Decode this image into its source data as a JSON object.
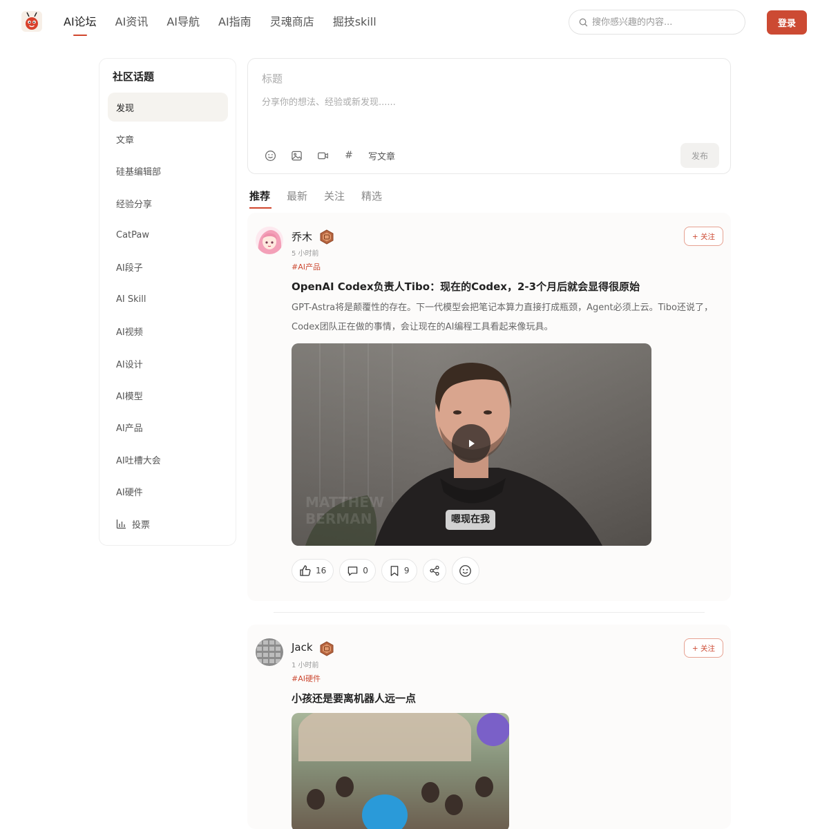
{
  "header": {
    "logo_icon": "ant-mascot-icon",
    "nav": [
      {
        "label": "AI论坛",
        "active": true
      },
      {
        "label": "AI资讯",
        "active": false
      },
      {
        "label": "AI导航",
        "active": false
      },
      {
        "label": "AI指南",
        "active": false
      },
      {
        "label": "灵魂商店",
        "active": false
      },
      {
        "label": "掘技skill",
        "active": false
      }
    ],
    "search_placeholder": "搜你感兴趣的内容...",
    "login_label": "登录",
    "accent_color": "#cc4a33"
  },
  "sidebar": {
    "title": "社区话题",
    "items": [
      {
        "label": "发现",
        "active": true
      },
      {
        "label": "文章"
      },
      {
        "label": "硅基编辑部"
      },
      {
        "label": "经验分享"
      },
      {
        "label": "CatPaw"
      },
      {
        "label": "AI段子"
      },
      {
        "label": "AI Skill"
      },
      {
        "label": "AI视频"
      },
      {
        "label": "AI设计"
      },
      {
        "label": "AI模型"
      },
      {
        "label": "AI产品"
      },
      {
        "label": "AI吐槽大会"
      },
      {
        "label": "AI硬件"
      },
      {
        "label": "投票",
        "icon": "bar-chart-icon"
      }
    ]
  },
  "composer": {
    "title_placeholder": "标题",
    "body_placeholder": "分享你的想法、经验或新发现......",
    "tools": [
      "emoji-icon",
      "image-icon",
      "video-icon",
      "hashtag-icon"
    ],
    "hashtag_glyph": "#",
    "write_article_label": "写文章",
    "publish_label": "发布"
  },
  "feed_tabs": [
    {
      "label": "推荐",
      "active": true
    },
    {
      "label": "最新",
      "active": false
    },
    {
      "label": "关注",
      "active": false
    },
    {
      "label": "精选",
      "active": false
    }
  ],
  "posts": [
    {
      "author": "乔木",
      "time": "5 小时前",
      "tag": "#AI产品",
      "title": "OpenAI Codex负责人Tibo：现在的Codex，2-3个月后就会显得很原始",
      "excerpt": "GPT-Astra将是颠覆性的存在。下一代模型会把笔记本算力直接打成瓶颈，Agent必须上云。Tibo还说了，Codex团队正在做的事情，会让现在的AI编程工具看起来像玩具。",
      "follow_label": "+ 关注",
      "video_caption": "嗯现在我",
      "likes": "16",
      "comments": "0",
      "bookmarks": "9"
    },
    {
      "author": "Jack",
      "time": "1 小时前",
      "tag": "#AI硬件",
      "title": "小孩还是要离机器人远一点",
      "follow_label": "+ 关注"
    }
  ]
}
